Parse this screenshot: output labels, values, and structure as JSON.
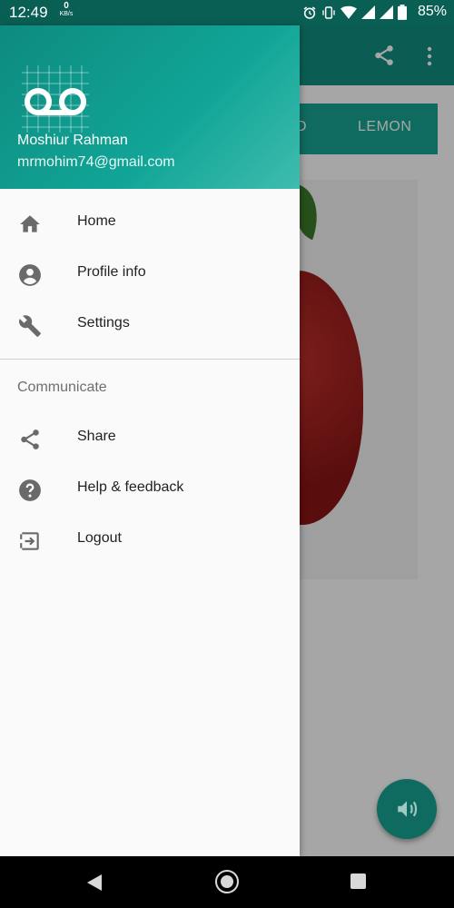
{
  "status_bar": {
    "time": "12:49",
    "speed_value": "0",
    "speed_unit": "KB/s",
    "battery_percent": "85%",
    "icons": [
      "alarm-icon",
      "vibrate-icon",
      "wifi-icon",
      "signal-icon",
      "signal-icon",
      "battery-icon"
    ]
  },
  "app": {
    "tabs": [
      {
        "label": "D"
      },
      {
        "label": "LEMON"
      }
    ],
    "toolbar_icons": [
      "share-icon",
      "more-vert-icon"
    ],
    "fab_icon": "volume-icon"
  },
  "drawer": {
    "user": {
      "name": "Moshiur Rahman",
      "email": "mrmohim74@gmail.com"
    },
    "menu": [
      {
        "label": "Home",
        "icon": "home-icon"
      },
      {
        "label": "Profile info",
        "icon": "account-circle-icon"
      },
      {
        "label": "Settings",
        "icon": "wrench-icon"
      }
    ],
    "section_title": "Communicate",
    "communicate": [
      {
        "label": "Share",
        "icon": "share-icon"
      },
      {
        "label": "Help & feedback",
        "icon": "help-icon"
      },
      {
        "label": "Logout",
        "icon": "logout-icon"
      }
    ]
  },
  "colors": {
    "primary": "#118f80",
    "primary_dark": "#0a5f55",
    "icon_gray": "#6a6a6a"
  }
}
